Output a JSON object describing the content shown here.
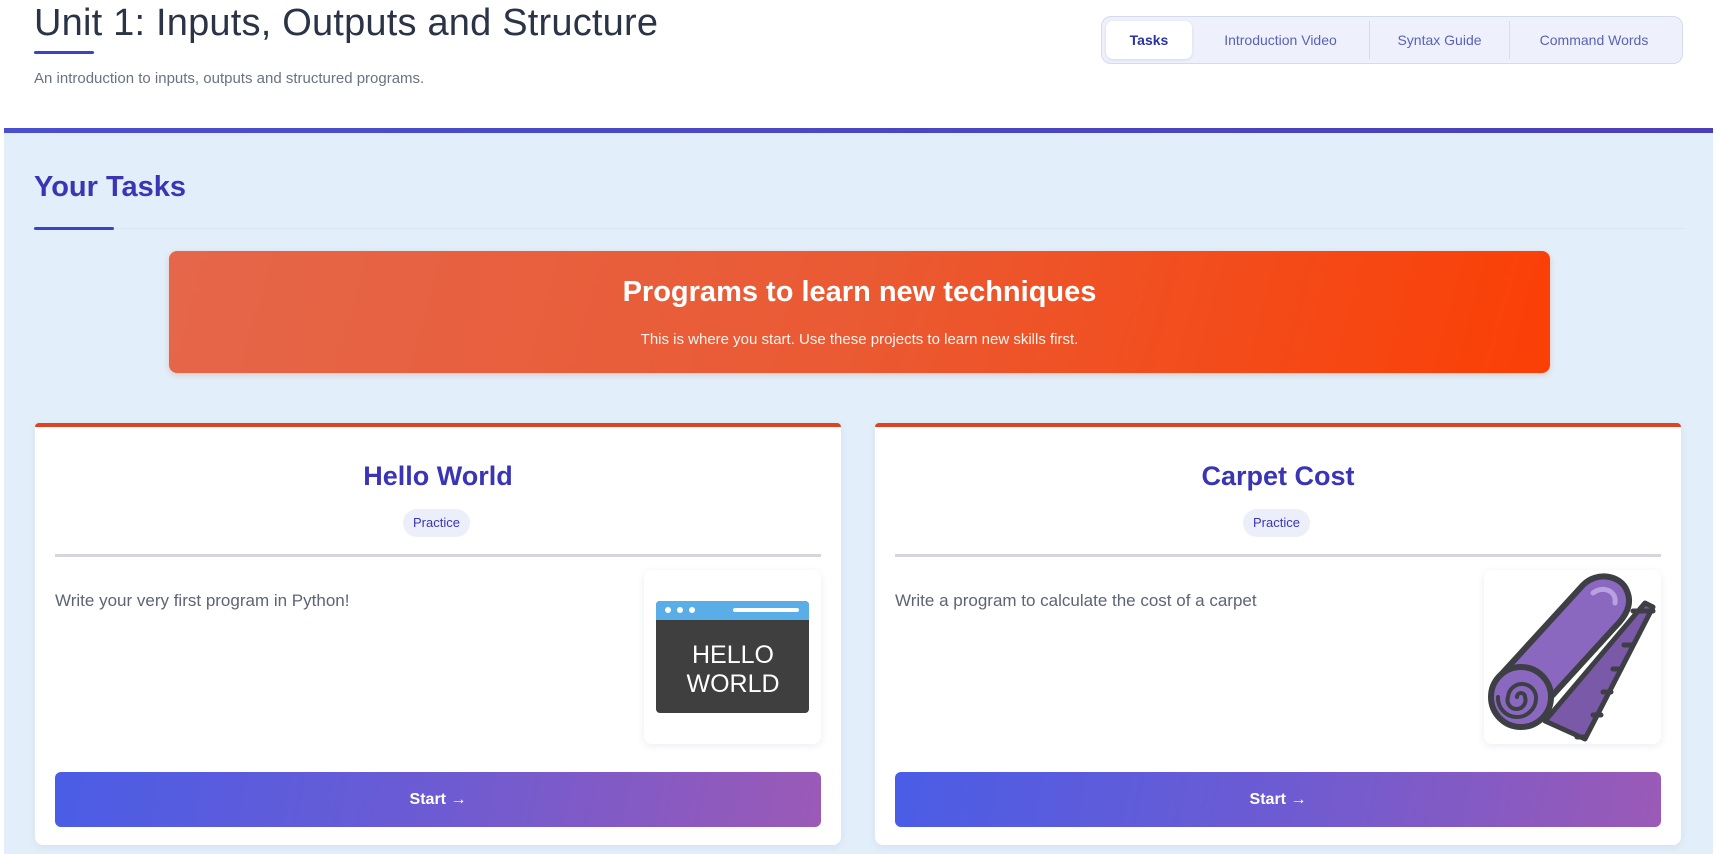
{
  "header": {
    "title": "Unit 1: Inputs, Outputs and Structure",
    "subtitle": "An introduction to inputs, outputs and structured programs."
  },
  "tabs": [
    {
      "label": "Tasks",
      "active": true
    },
    {
      "label": "Introduction Video",
      "active": false
    },
    {
      "label": "Syntax Guide",
      "active": false
    },
    {
      "label": "Command Words",
      "active": false
    }
  ],
  "section": {
    "title": "Your Tasks"
  },
  "banner": {
    "title": "Programs to learn new techniques",
    "text": "This is where you start. Use these projects to learn new skills first."
  },
  "cards": [
    {
      "title": "Hello World",
      "badge": "Practice",
      "description": "Write your very first program in Python!",
      "image_icon": "hello-world-browser-icon",
      "image_text_line1": "HELLO",
      "image_text_line2": "WORLD",
      "button_label": "Start →"
    },
    {
      "title": "Carpet Cost",
      "badge": "Practice",
      "description": "Write a program to calculate the cost of a carpet",
      "image_icon": "rolled-carpet-icon",
      "button_label": "Start →"
    }
  ],
  "colors": {
    "accent": "#3a35b5",
    "banner_start": "#e5664a",
    "banner_end": "#fb3f05",
    "card_top_border": "#e0421f",
    "button_start": "#4a5de6",
    "button_end": "#9b5ab6",
    "carpet_purple": "#8a68c0"
  }
}
